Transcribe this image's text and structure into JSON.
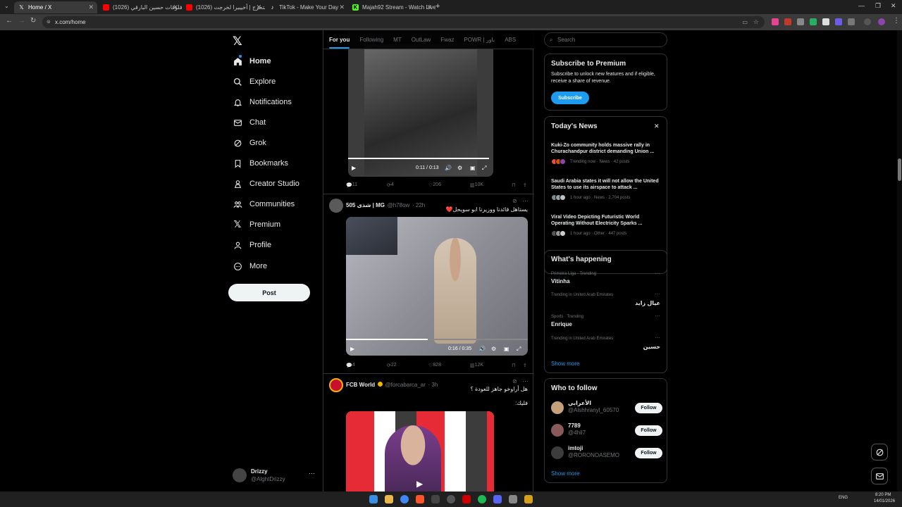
{
  "browser": {
    "tabs": [
      {
        "title": "Home / X",
        "active": true
      },
      {
        "title": "(1026) فلوقات حسين البارقي - ...",
        "active": false
      },
      {
        "title": "(1026) فلوق التخرج | أخيييرا لخرجت...",
        "active": false
      },
      {
        "title": "TikTok - Make Your Day",
        "active": false
      },
      {
        "title": "Majah92 Stream - Watch Live o...",
        "active": false
      }
    ],
    "url": "x.com/home"
  },
  "sidebar": {
    "items": [
      {
        "label": "Home",
        "icon": "home-icon"
      },
      {
        "label": "Explore",
        "icon": "search-icon"
      },
      {
        "label": "Notifications",
        "icon": "bell-icon"
      },
      {
        "label": "Chat",
        "icon": "mail-icon"
      },
      {
        "label": "Grok",
        "icon": "grok-icon"
      },
      {
        "label": "Bookmarks",
        "icon": "bookmark-icon"
      },
      {
        "label": "Creator Studio",
        "icon": "creator-icon"
      },
      {
        "label": "Communities",
        "icon": "communities-icon"
      },
      {
        "label": "Premium",
        "icon": "x-logo-icon"
      },
      {
        "label": "Profile",
        "icon": "profile-icon"
      },
      {
        "label": "More",
        "icon": "more-circle-icon"
      }
    ],
    "post_label": "Post",
    "account": {
      "name": "Drizzy",
      "handle": "@AlghtDrizzy"
    }
  },
  "feed": {
    "tabs": [
      "For you",
      "Following",
      "MT",
      "OutLaw",
      "Fwaz",
      "POWR | باور",
      "ABS"
    ],
    "post1": {
      "time": "0:11 / 0:13",
      "replies": "11",
      "reposts": "4",
      "likes": "206",
      "views": "10K"
    },
    "post2": {
      "name": "505 شذى | MG",
      "handle": "@h78ow",
      "age": "· 22h",
      "text": "يستاهل قائدنا ووزيرنا ابو سويحل❤️",
      "time": "0:16 / 0:35",
      "replies": "4",
      "reposts": "22",
      "likes": "828",
      "views": "12K"
    },
    "post3": {
      "name": "FCB World",
      "handle": "@forcabarca_ar",
      "age": "· 3h",
      "text": "هل أراوخو جاهز للعودة ؟",
      "text2": "فليك:"
    }
  },
  "right": {
    "search_placeholder": "Search",
    "premium": {
      "title": "Subscribe to Premium",
      "body": "Subscribe to unlock new features and if eligible, receive a share of revenue.",
      "button": "Subscribe"
    },
    "news": {
      "title": "Today's News",
      "items": [
        {
          "headline": "Kuki-Zo community holds massive rally in Churachandpur district demanding Union ...",
          "meta": "Trending now · News · 42 posts"
        },
        {
          "headline": "Saudi Arabia states it will not allow the United States to use its airspace to attack ...",
          "meta": "1 hour ago · News · 2,704 posts"
        },
        {
          "headline": "Viral Video Depicting Futuristic World Operating Without Electricity Sparks ...",
          "meta": "1 hour ago · Other · 447 posts"
        }
      ]
    },
    "happening": {
      "title": "What's happening",
      "items": [
        {
          "meta": "Primeira Liga · Trending",
          "topic": "Vitinha"
        },
        {
          "meta": "Trending in United Arab Emirates",
          "topic": "عيال زايد"
        },
        {
          "meta": "Sports · Trending",
          "topic": "Enrique"
        },
        {
          "meta": "Trending in United Arab Emirates",
          "topic": "حسين"
        }
      ],
      "show_more": "Show more"
    },
    "follow": {
      "title": "Who to follow",
      "items": [
        {
          "name": "الأعرابي",
          "handle": "@Alshhranyl_60570",
          "button": "Follow"
        },
        {
          "name": "7789",
          "handle": "@4hil7",
          "button": "Follow"
        },
        {
          "name": "imtoji",
          "handle": "@RORONOASEMO",
          "button": "Follow"
        }
      ],
      "show_more": "Show more"
    }
  },
  "taskbar": {
    "lang": "ENG",
    "time": "8:20 PM",
    "date": "14/01/2026"
  },
  "colors": {
    "accent": "#1d9bf0",
    "background": "#000000",
    "border": "#2f3336",
    "muted": "#71767b"
  }
}
